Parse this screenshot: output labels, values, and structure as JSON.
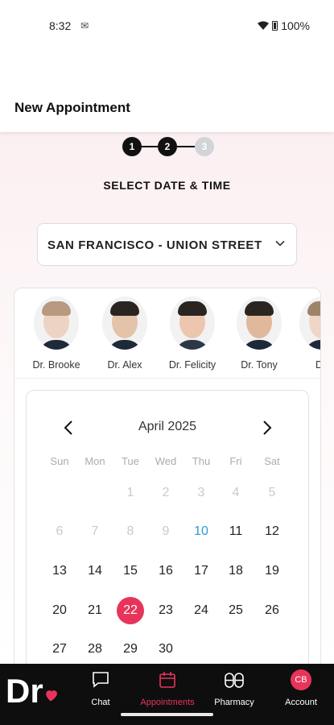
{
  "status": {
    "time": "8:32",
    "battery": "100%"
  },
  "header": {
    "title": "New Appointment"
  },
  "stepper": {
    "steps": [
      "1",
      "2",
      "3"
    ],
    "current": 2
  },
  "section_title": "SELECT DATE & TIME",
  "location": {
    "selected": "SAN FRANCISCO - UNION STREET"
  },
  "doctors": [
    {
      "name": "Dr. Brooke"
    },
    {
      "name": "Dr. Alex"
    },
    {
      "name": "Dr. Felicity"
    },
    {
      "name": "Dr. Tony"
    },
    {
      "name": "Dr."
    }
  ],
  "calendar": {
    "month": "April 2025",
    "prev_icon": "chevron-left-icon",
    "next_icon": "chevron-right-icon",
    "weekdays": [
      "Sun",
      "Mon",
      "Tue",
      "Wed",
      "Thu",
      "Fri",
      "Sat"
    ],
    "days": [
      "1",
      "2",
      "3",
      "4",
      "5",
      "6",
      "7",
      "8",
      "9",
      "10",
      "11",
      "12",
      "13",
      "14",
      "15",
      "16",
      "17",
      "18",
      "19",
      "20",
      "21",
      "22",
      "23",
      "24",
      "25",
      "26",
      "27",
      "28",
      "29",
      "30"
    ],
    "today": "10",
    "selected": "22",
    "last_disabled": "9"
  },
  "tabs": [
    {
      "label": "Chat",
      "icon": "chat-icon"
    },
    {
      "label": "Appointments",
      "icon": "calendar-icon",
      "active": true
    },
    {
      "label": "Pharmacy",
      "icon": "pills-icon"
    },
    {
      "label": "Account",
      "icon": "avatar-badge",
      "initials": "CB"
    }
  ],
  "logo": {
    "text": "Dr"
  },
  "colors": {
    "accent": "#e8345a",
    "today": "#2b9bd6",
    "tabbar": "#0e0e0e"
  }
}
